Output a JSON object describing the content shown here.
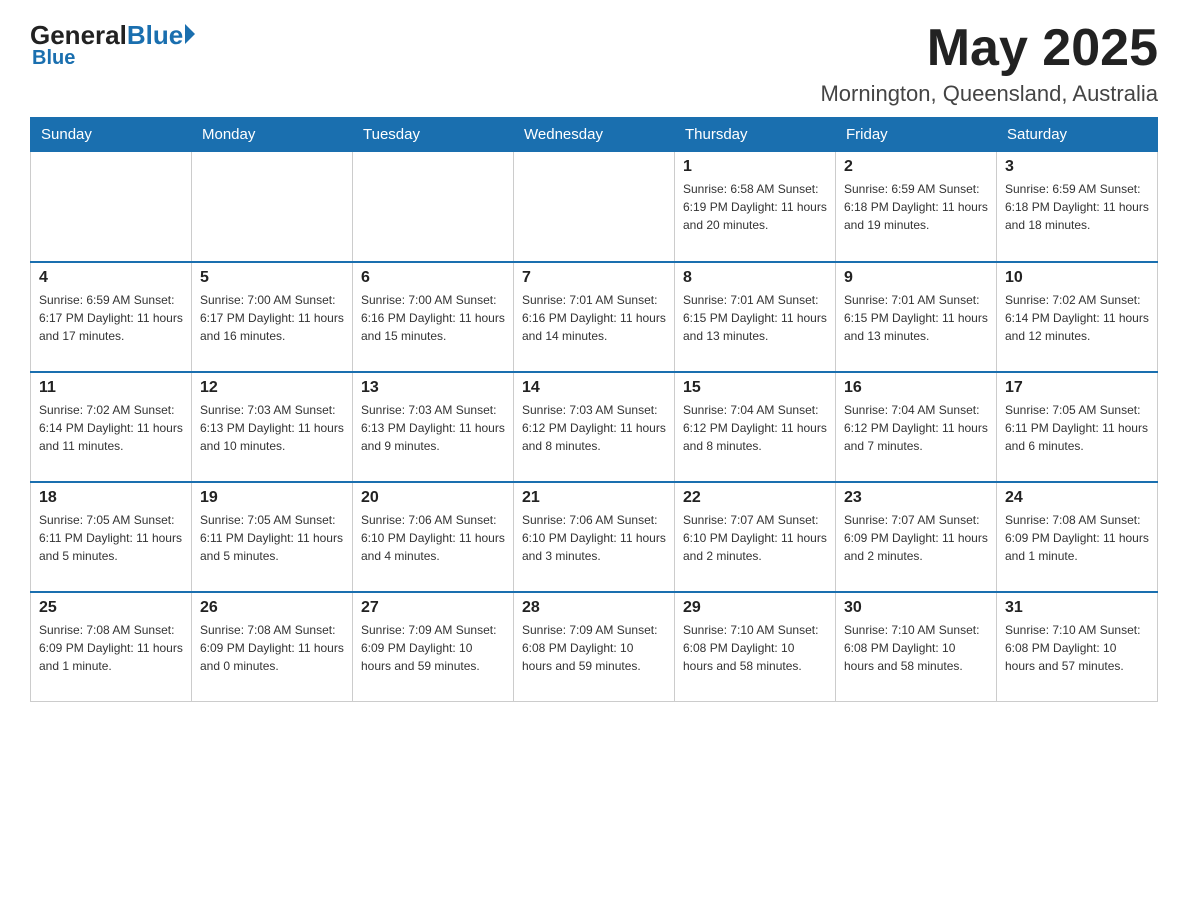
{
  "header": {
    "logo_general": "General",
    "logo_blue": "Blue",
    "month_year": "May 2025",
    "location": "Mornington, Queensland, Australia"
  },
  "weekdays": [
    "Sunday",
    "Monday",
    "Tuesday",
    "Wednesday",
    "Thursday",
    "Friday",
    "Saturday"
  ],
  "weeks": [
    [
      {
        "day": "",
        "info": ""
      },
      {
        "day": "",
        "info": ""
      },
      {
        "day": "",
        "info": ""
      },
      {
        "day": "",
        "info": ""
      },
      {
        "day": "1",
        "info": "Sunrise: 6:58 AM\nSunset: 6:19 PM\nDaylight: 11 hours and 20 minutes."
      },
      {
        "day": "2",
        "info": "Sunrise: 6:59 AM\nSunset: 6:18 PM\nDaylight: 11 hours and 19 minutes."
      },
      {
        "day": "3",
        "info": "Sunrise: 6:59 AM\nSunset: 6:18 PM\nDaylight: 11 hours and 18 minutes."
      }
    ],
    [
      {
        "day": "4",
        "info": "Sunrise: 6:59 AM\nSunset: 6:17 PM\nDaylight: 11 hours and 17 minutes."
      },
      {
        "day": "5",
        "info": "Sunrise: 7:00 AM\nSunset: 6:17 PM\nDaylight: 11 hours and 16 minutes."
      },
      {
        "day": "6",
        "info": "Sunrise: 7:00 AM\nSunset: 6:16 PM\nDaylight: 11 hours and 15 minutes."
      },
      {
        "day": "7",
        "info": "Sunrise: 7:01 AM\nSunset: 6:16 PM\nDaylight: 11 hours and 14 minutes."
      },
      {
        "day": "8",
        "info": "Sunrise: 7:01 AM\nSunset: 6:15 PM\nDaylight: 11 hours and 13 minutes."
      },
      {
        "day": "9",
        "info": "Sunrise: 7:01 AM\nSunset: 6:15 PM\nDaylight: 11 hours and 13 minutes."
      },
      {
        "day": "10",
        "info": "Sunrise: 7:02 AM\nSunset: 6:14 PM\nDaylight: 11 hours and 12 minutes."
      }
    ],
    [
      {
        "day": "11",
        "info": "Sunrise: 7:02 AM\nSunset: 6:14 PM\nDaylight: 11 hours and 11 minutes."
      },
      {
        "day": "12",
        "info": "Sunrise: 7:03 AM\nSunset: 6:13 PM\nDaylight: 11 hours and 10 minutes."
      },
      {
        "day": "13",
        "info": "Sunrise: 7:03 AM\nSunset: 6:13 PM\nDaylight: 11 hours and 9 minutes."
      },
      {
        "day": "14",
        "info": "Sunrise: 7:03 AM\nSunset: 6:12 PM\nDaylight: 11 hours and 8 minutes."
      },
      {
        "day": "15",
        "info": "Sunrise: 7:04 AM\nSunset: 6:12 PM\nDaylight: 11 hours and 8 minutes."
      },
      {
        "day": "16",
        "info": "Sunrise: 7:04 AM\nSunset: 6:12 PM\nDaylight: 11 hours and 7 minutes."
      },
      {
        "day": "17",
        "info": "Sunrise: 7:05 AM\nSunset: 6:11 PM\nDaylight: 11 hours and 6 minutes."
      }
    ],
    [
      {
        "day": "18",
        "info": "Sunrise: 7:05 AM\nSunset: 6:11 PM\nDaylight: 11 hours and 5 minutes."
      },
      {
        "day": "19",
        "info": "Sunrise: 7:05 AM\nSunset: 6:11 PM\nDaylight: 11 hours and 5 minutes."
      },
      {
        "day": "20",
        "info": "Sunrise: 7:06 AM\nSunset: 6:10 PM\nDaylight: 11 hours and 4 minutes."
      },
      {
        "day": "21",
        "info": "Sunrise: 7:06 AM\nSunset: 6:10 PM\nDaylight: 11 hours and 3 minutes."
      },
      {
        "day": "22",
        "info": "Sunrise: 7:07 AM\nSunset: 6:10 PM\nDaylight: 11 hours and 2 minutes."
      },
      {
        "day": "23",
        "info": "Sunrise: 7:07 AM\nSunset: 6:09 PM\nDaylight: 11 hours and 2 minutes."
      },
      {
        "day": "24",
        "info": "Sunrise: 7:08 AM\nSunset: 6:09 PM\nDaylight: 11 hours and 1 minute."
      }
    ],
    [
      {
        "day": "25",
        "info": "Sunrise: 7:08 AM\nSunset: 6:09 PM\nDaylight: 11 hours and 1 minute."
      },
      {
        "day": "26",
        "info": "Sunrise: 7:08 AM\nSunset: 6:09 PM\nDaylight: 11 hours and 0 minutes."
      },
      {
        "day": "27",
        "info": "Sunrise: 7:09 AM\nSunset: 6:09 PM\nDaylight: 10 hours and 59 minutes."
      },
      {
        "day": "28",
        "info": "Sunrise: 7:09 AM\nSunset: 6:08 PM\nDaylight: 10 hours and 59 minutes."
      },
      {
        "day": "29",
        "info": "Sunrise: 7:10 AM\nSunset: 6:08 PM\nDaylight: 10 hours and 58 minutes."
      },
      {
        "day": "30",
        "info": "Sunrise: 7:10 AM\nSunset: 6:08 PM\nDaylight: 10 hours and 58 minutes."
      },
      {
        "day": "31",
        "info": "Sunrise: 7:10 AM\nSunset: 6:08 PM\nDaylight: 10 hours and 57 minutes."
      }
    ]
  ]
}
